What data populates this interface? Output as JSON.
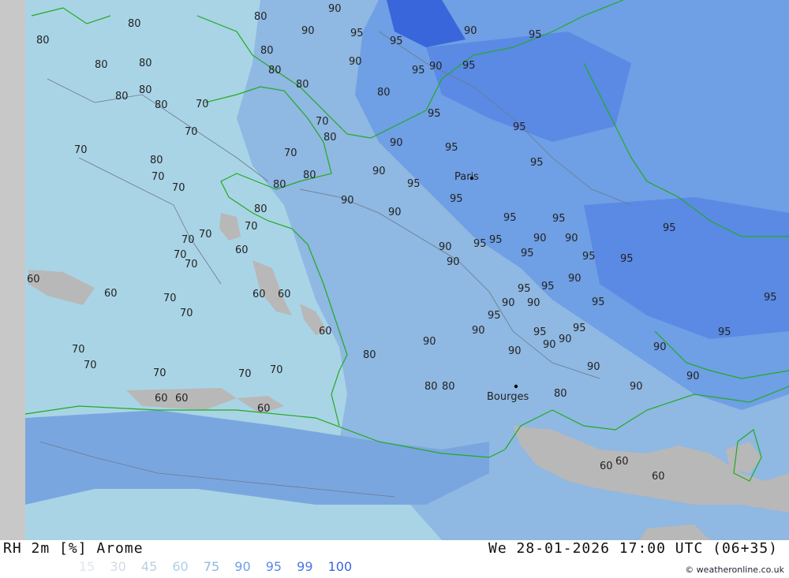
{
  "title": "RH 2m [%] Arome",
  "datetime": "We 28-01-2026 17:00 UTC (06+35)",
  "credit": "© weatheronline.co.uk",
  "legend": [
    {
      "value": "15",
      "color": "#dfe8ee"
    },
    {
      "value": "30",
      "color": "#cfdbe4"
    },
    {
      "value": "45",
      "color": "#bccfdc"
    },
    {
      "value": "60",
      "color": "#a8d2e6"
    },
    {
      "value": "75",
      "color": "#8fb8e2"
    },
    {
      "value": "90",
      "color": "#6f9fe4"
    },
    {
      "value": "95",
      "color": "#5a8ae4"
    },
    {
      "value": "99",
      "color": "#4878e0"
    },
    {
      "value": "100",
      "color": "#3a66dc"
    }
  ],
  "places": [
    {
      "name": "Paris",
      "icon": "city-dot-icon"
    },
    {
      "name": "Bourges",
      "icon": "city-dot-icon"
    }
  ],
  "contour_labels": [
    "80",
    "80",
    "80",
    "80",
    "80",
    "80",
    "80",
    "80",
    "80",
    "80",
    "80",
    "80",
    "80",
    "80",
    "80",
    "80",
    "80",
    "80",
    "80",
    "80",
    "80",
    "70",
    "70",
    "70",
    "70",
    "70",
    "70",
    "70",
    "70",
    "70",
    "70",
    "70",
    "70",
    "70",
    "70",
    "70",
    "70",
    "70",
    "70",
    "70",
    "60",
    "60",
    "60",
    "60",
    "60",
    "60",
    "60",
    "60",
    "60",
    "60",
    "60",
    "60",
    "90",
    "90",
    "90",
    "90",
    "90",
    "90",
    "90",
    "90",
    "90",
    "90",
    "90",
    "90",
    "90",
    "90",
    "90",
    "90",
    "90",
    "90",
    "90",
    "90",
    "90",
    "90",
    "90",
    "90",
    "90",
    "95",
    "95",
    "95",
    "95",
    "95",
    "95",
    "95",
    "95",
    "95",
    "95",
    "95",
    "95",
    "95",
    "95",
    "95",
    "95",
    "95",
    "95",
    "95",
    "95",
    "95",
    "95",
    "95",
    "95",
    "95",
    "95",
    "95"
  ]
}
